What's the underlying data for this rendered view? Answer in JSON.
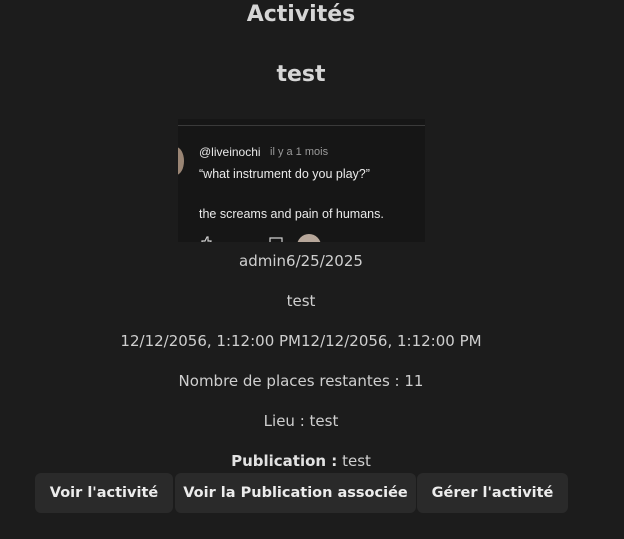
{
  "page": {
    "title": "Activités",
    "activity_name": "test"
  },
  "post": {
    "handle": "@liveinochi",
    "time": "il y a 1 mois",
    "quote": "“what instrument do you play?”",
    "body": "the screams and pain of humans."
  },
  "activity": {
    "author_date": "admin6/25/2025",
    "description": "test",
    "dates": "12/12/2056, 1:12:00 PM12/12/2056, 1:12:00 PM",
    "places": "Nombre de places restantes : 11",
    "location": "Lieu : test",
    "publication_label": "Publication :",
    "publication_value": "test"
  },
  "buttons": {
    "view": "Voir l'activité",
    "view_publication": "Voir la Publication associée",
    "manage": "Gérer l'activité"
  }
}
